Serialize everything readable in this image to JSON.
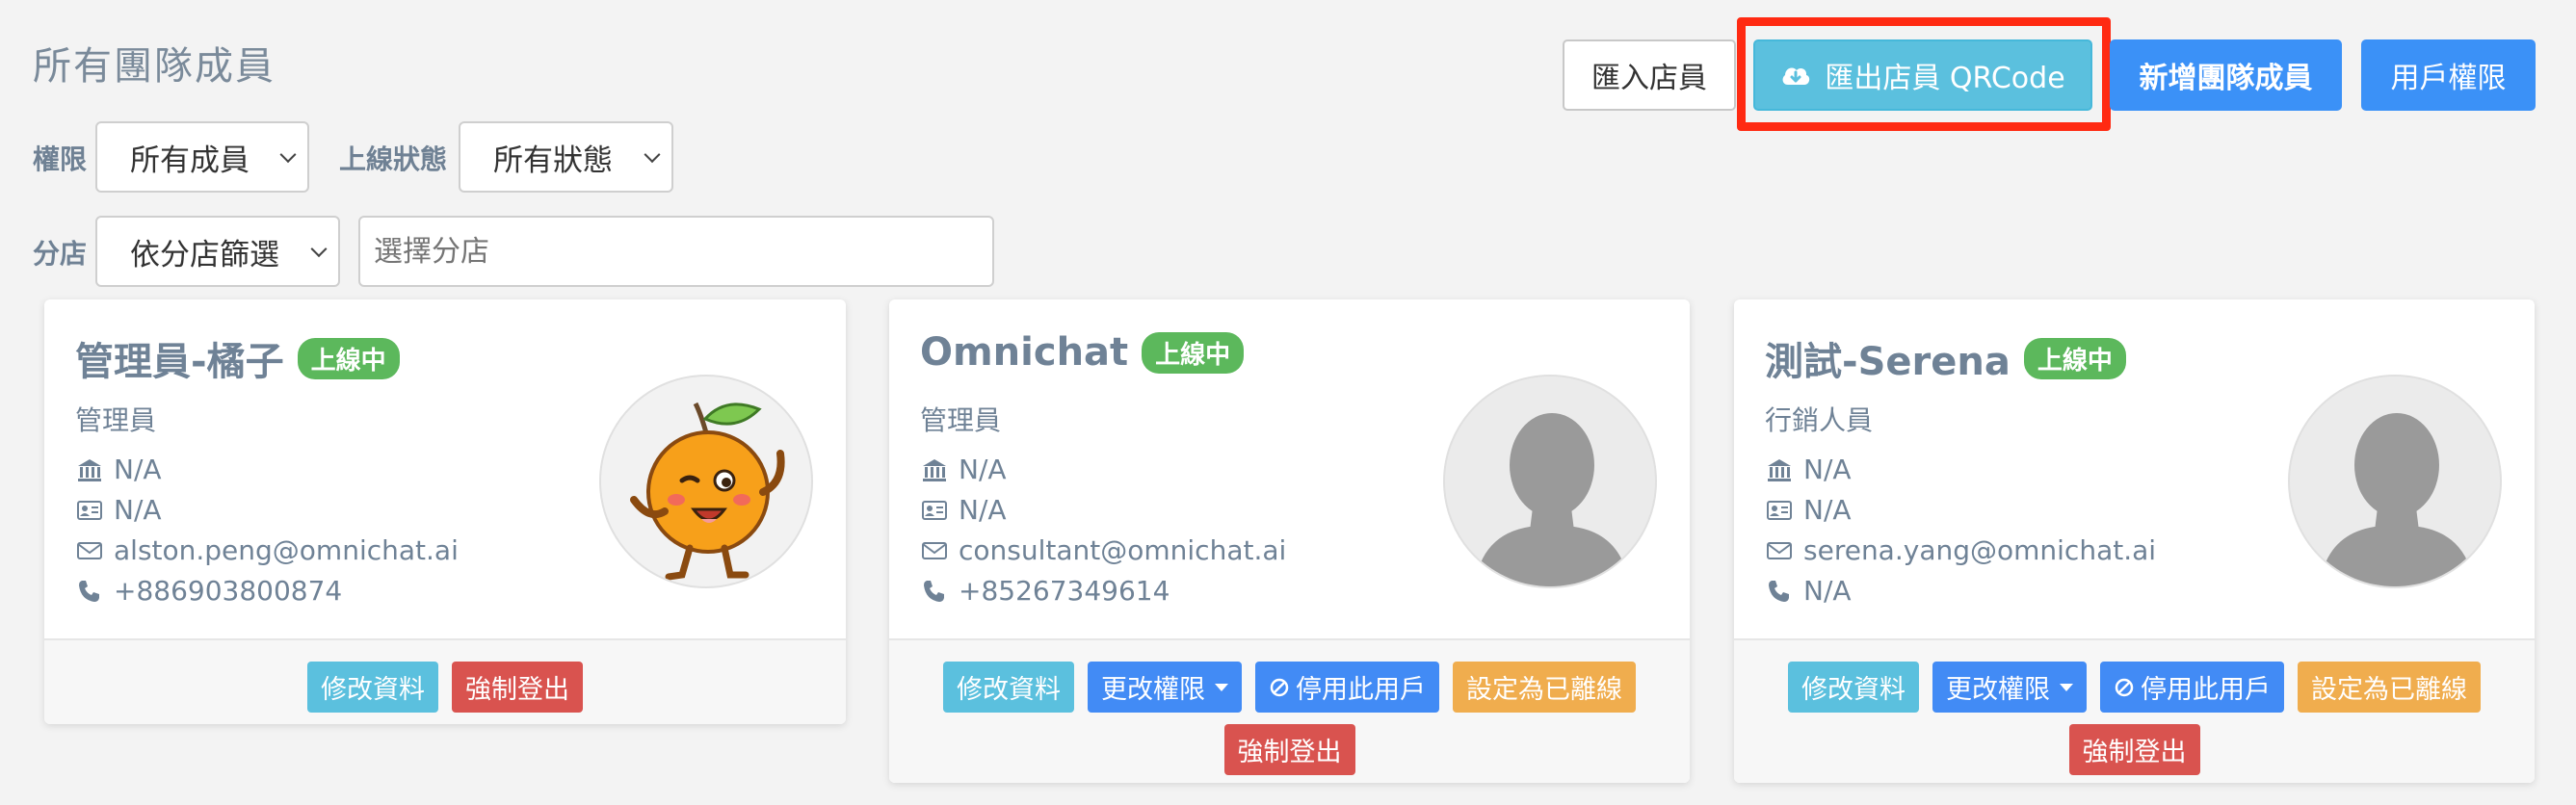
{
  "page": {
    "title": "所有團隊成員"
  },
  "toolbar": {
    "import_label": "匯入店員",
    "export_label": "匯出店員 QRCode",
    "add_label": "新增團隊成員",
    "permission_label": "用戶權限"
  },
  "filters": {
    "permission_label": "權限",
    "permission_value": "所有成員",
    "status_label": "上線狀態",
    "status_value": "所有狀態",
    "branch_label": "分店",
    "branch_value": "依分店篩選",
    "branch_search_placeholder": "選擇分店"
  },
  "colors": {
    "accent": "#3b91f7",
    "online": "#5cb85c",
    "highlight": "#ff2a12"
  },
  "members": [
    {
      "name": "管理員-橘子",
      "status": "上線中",
      "role": "管理員",
      "branch": "N/A",
      "id": "N/A",
      "email": "alston.peng@omnichat.ai",
      "phone": "+886903800874",
      "avatar": "orange-mascot",
      "actions": {
        "edit": "修改資料",
        "logout": "強制登出"
      }
    },
    {
      "name": "Omnichat",
      "status": "上線中",
      "role": "管理員",
      "branch": "N/A",
      "id": "N/A",
      "email": "consultant@omnichat.ai",
      "phone": "+85267349614",
      "avatar": "default-silhouette",
      "actions": {
        "edit": "修改資料",
        "change_perm": "更改權限",
        "disable": "停用此用戶",
        "set_offline": "設定為已離線",
        "logout": "強制登出"
      }
    },
    {
      "name": "測試-Serena",
      "status": "上線中",
      "role": "行銷人員",
      "branch": "N/A",
      "id": "N/A",
      "email": "serena.yang@omnichat.ai",
      "phone": "N/A",
      "avatar": "default-silhouette",
      "actions": {
        "edit": "修改資料",
        "change_perm": "更改權限",
        "disable": "停用此用戶",
        "set_offline": "設定為已離線",
        "logout": "強制登出"
      }
    }
  ]
}
